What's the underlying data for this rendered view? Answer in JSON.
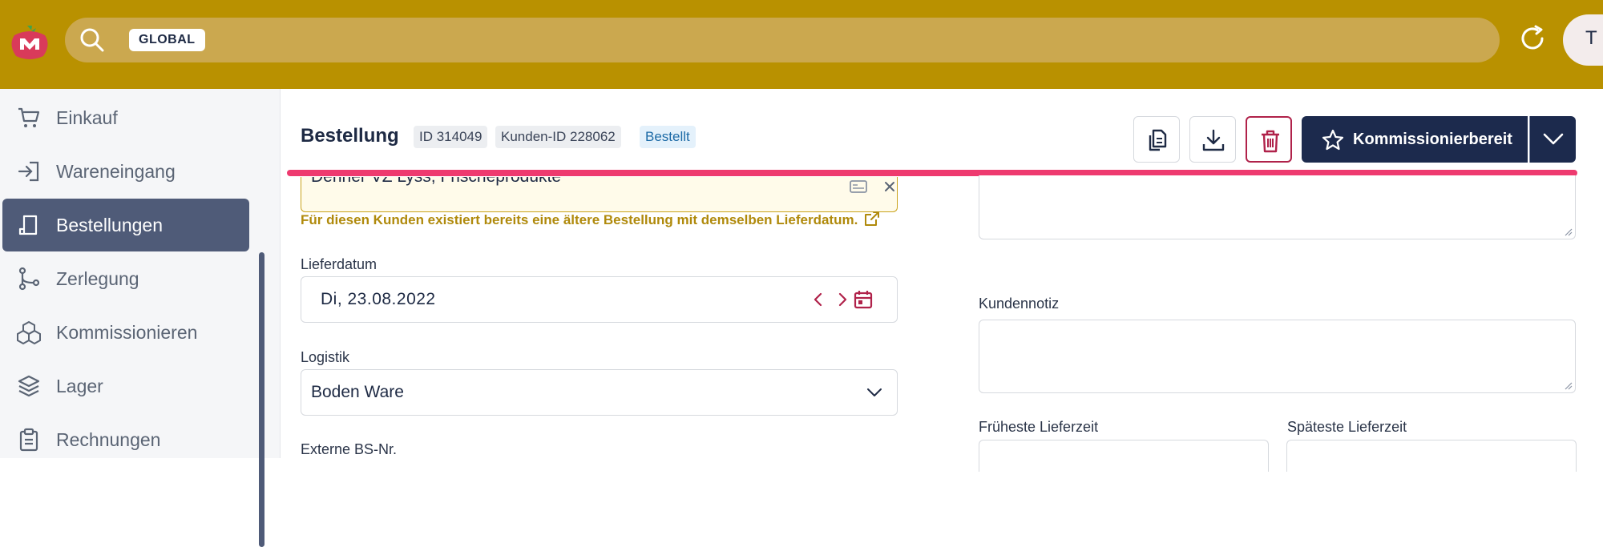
{
  "topbar": {
    "search": {
      "scope_chip": "GLOBAL"
    },
    "avatar_initial": "T",
    "colors": {
      "bar": "#b99100",
      "search": "#cba84f"
    }
  },
  "sidebar": {
    "items": [
      {
        "label": "Einkauf",
        "icon": "cart-icon",
        "active": false
      },
      {
        "label": "Wareneingang",
        "icon": "sign-in-icon",
        "active": false
      },
      {
        "label": "Bestellungen",
        "icon": "order-icon",
        "active": true
      },
      {
        "label": "Zerlegung",
        "icon": "branch-icon",
        "active": false
      },
      {
        "label": "Kommissionieren",
        "icon": "boxes-icon",
        "active": false
      },
      {
        "label": "Lager",
        "icon": "layers-icon",
        "active": false
      },
      {
        "label": "Rechnungen",
        "icon": "clipboard-icon",
        "active": false
      }
    ]
  },
  "header": {
    "title": "Bestellung",
    "id_chip": "ID 314049",
    "customer_id_chip": "Kunden-ID 228062",
    "status_chip": "Bestellt",
    "primary_action": "Kommissionierbereit"
  },
  "form": {
    "customer_value": "Denner VZ Lyss, Frischeprodukte",
    "warning": "Für diesen Kunden existiert bereits eine ältere Bestellung mit demselben Lieferdatum.",
    "delivery_date": {
      "label": "Lieferdatum",
      "value": "Di,  23.08.2022"
    },
    "logistics": {
      "label": "Logistik",
      "value": "Boden Ware"
    },
    "external_no": {
      "label": "Externe BS-Nr."
    },
    "customer_note": {
      "label": "Kundennotiz"
    },
    "earliest_time": {
      "label": "Früheste Lieferzeit"
    },
    "latest_time": {
      "label": "Späteste Lieferzeit"
    }
  },
  "colors": {
    "accent": "#ee3a6f",
    "primary": "#1c2a4d",
    "danger": "#b0224a",
    "warning": "#b08a0c"
  }
}
